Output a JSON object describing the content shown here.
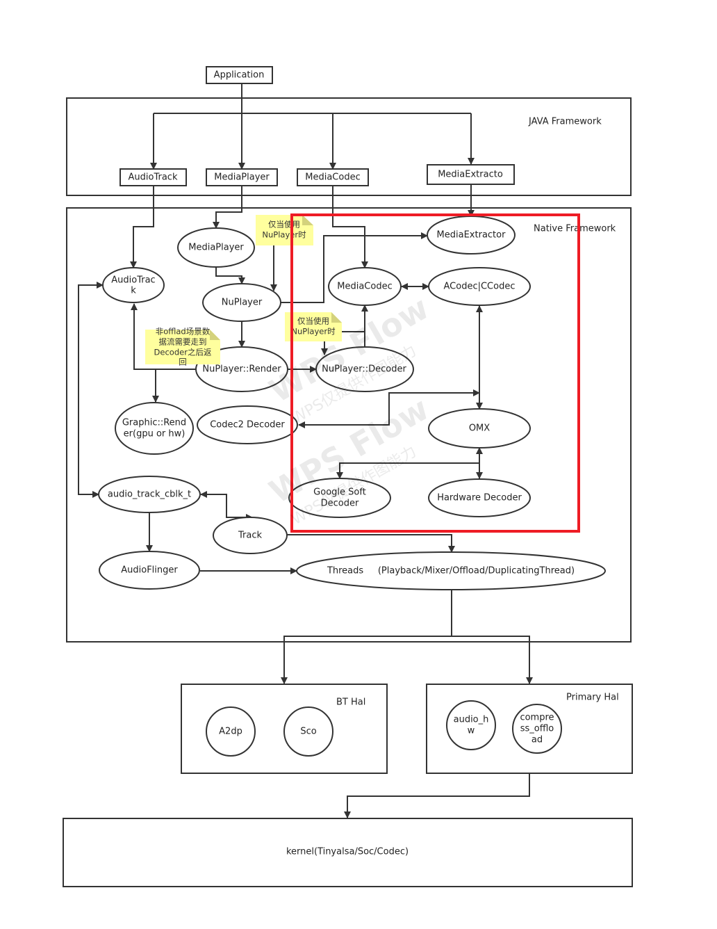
{
  "nodes": {
    "application": "Application",
    "java_framework": "JAVA Framework",
    "java_audiotrack": "AudioTrack",
    "java_mediaplayer": "MediaPlayer",
    "java_mediacodec": "MediaCodec",
    "java_mediaextractor": "MediaExtracto",
    "native_framework": "Native Framework",
    "mediaplayer": "MediaPlayer",
    "mediaextractor": "MediaExtractor",
    "audiotrack_l1": "AudioTrac",
    "audiotrack_l2": "k",
    "nuplayer": "NuPlayer",
    "mediacodec": "MediaCodec",
    "acodec": "ACodec|CCodec",
    "nuplayer_render": "NuPlayer::Render",
    "nuplayer_decoder": "NuPlayer::Decoder",
    "graphic_l1": "Graphic::Rend",
    "graphic_l2": "er(gpu or hw)",
    "codec2": "Codec2 Decoder",
    "omx": "OMX",
    "cblk": "audio_track_cblk_t",
    "google_l1": "Google Soft",
    "google_l2": "Decoder",
    "hardware_decoder": "Hardware Decoder",
    "track": "Track",
    "audioflinger": "AudioFlinger",
    "threads": "Threads     (Playback/Mixer/Offload/DuplicatingThread)",
    "bt_hal": "BT Hal",
    "a2dp": "A2dp",
    "sco": "Sco",
    "primary_hal": "Primary Hal",
    "audiohw_l1": "audio_h",
    "audiohw_l2": "w",
    "compress_l1": "compre",
    "compress_l2": "ss_offlo",
    "compress_l3": "ad",
    "kernel": "kernel(Tinyalsa/Soc/Codec)"
  },
  "notes": {
    "note1_l1": "仅当使用",
    "note1_l2": "NuPlayer时",
    "note2_l1": "仅当使用",
    "note2_l2": "NuPlayer时",
    "note3_l1": "非offlad场景数",
    "note3_l2": "据流需要走到",
    "note3_l3": "Decoder之后返",
    "note3_l4": "回"
  },
  "watermark": {
    "brand": "WPS Flow",
    "notice": "WPS仅提供作图能力"
  },
  "colors": {
    "highlight": "#ee1c25",
    "note": "#ffff9e"
  }
}
